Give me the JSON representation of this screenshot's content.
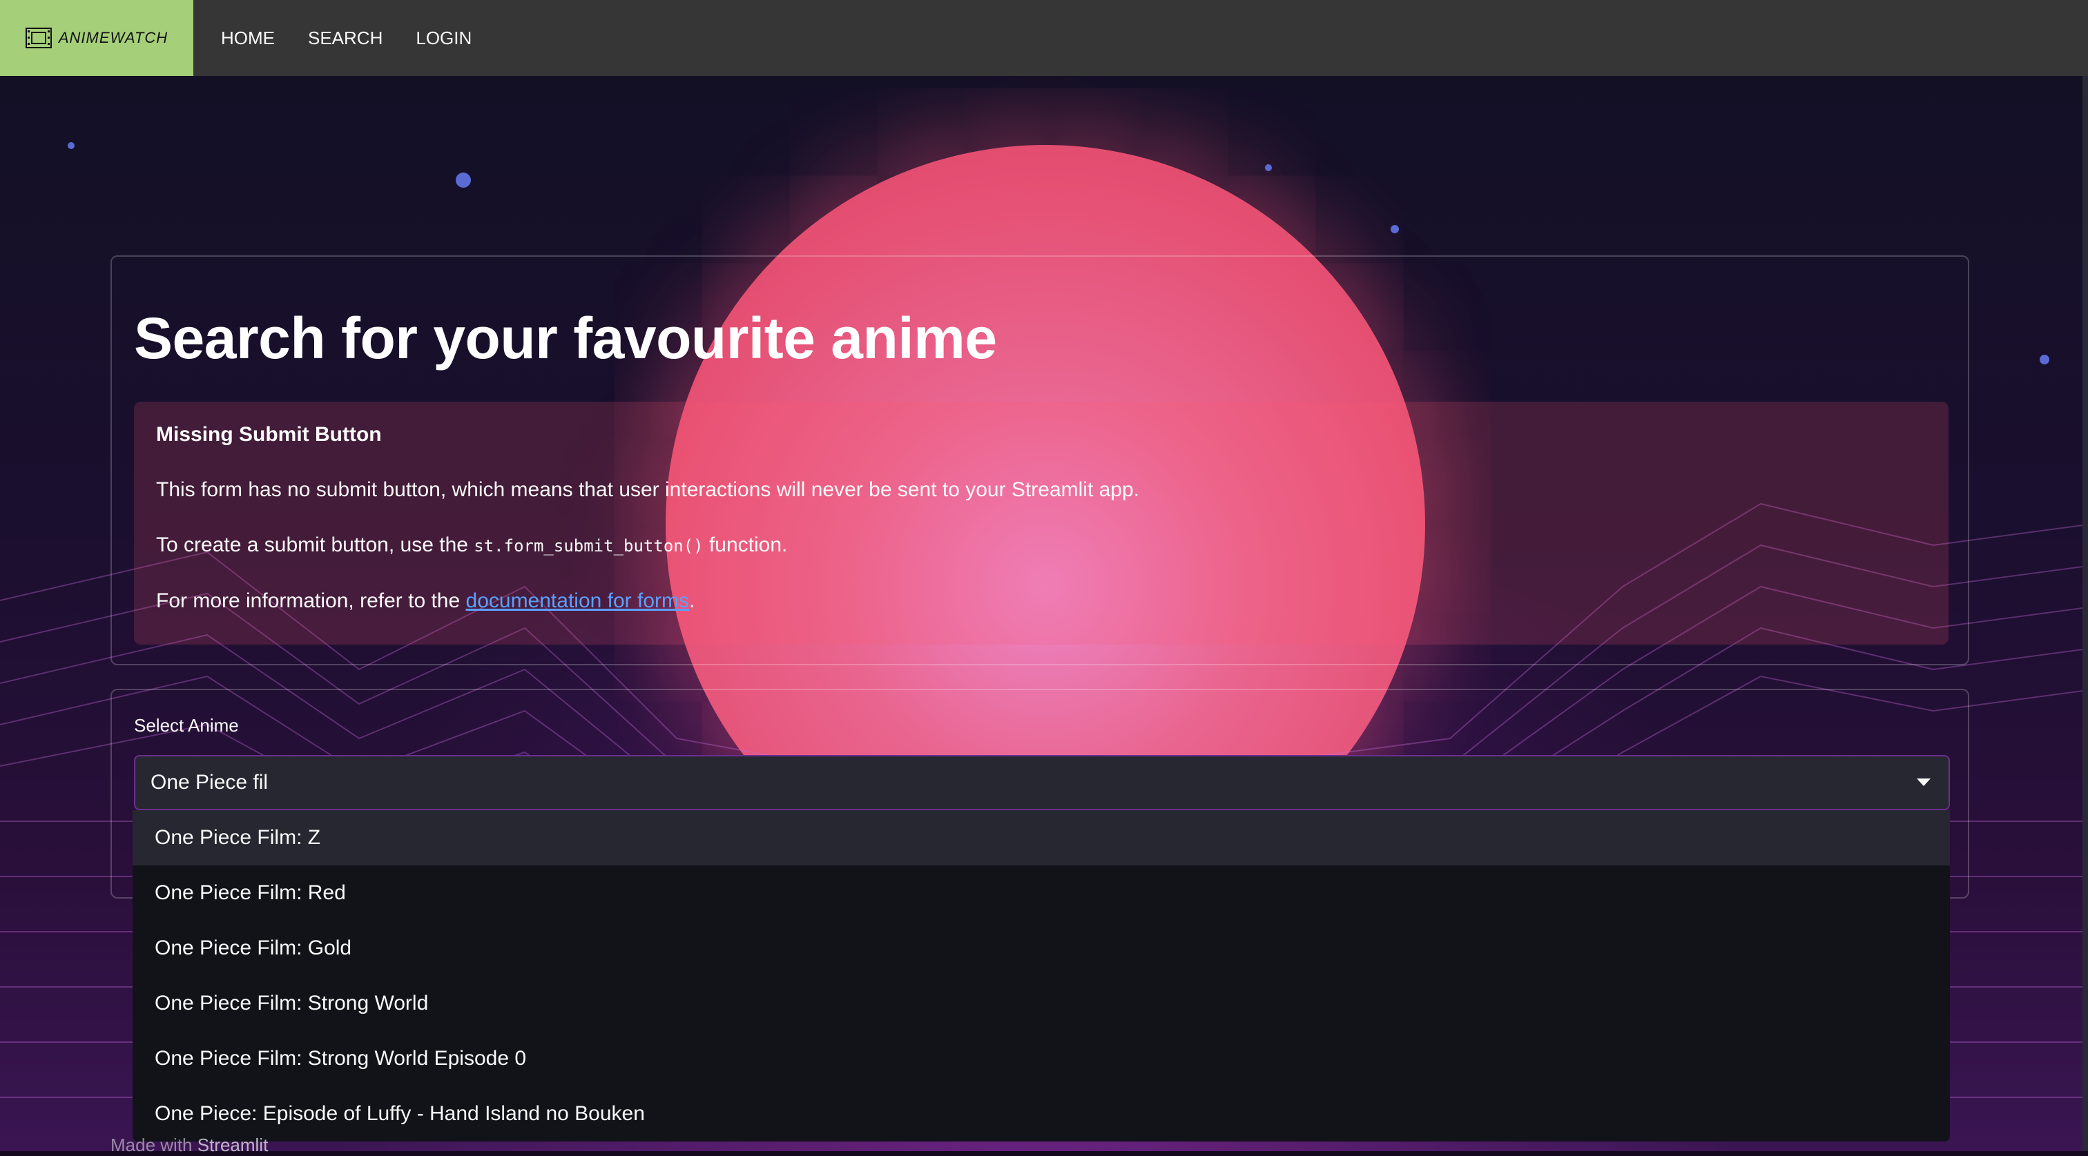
{
  "nav": {
    "logo_text": "ANIMEWATCH",
    "items": [
      "HOME",
      "SEARCH",
      "LOGIN"
    ]
  },
  "page": {
    "title": "Search for your favourite anime"
  },
  "alert": {
    "heading": "Missing Submit Button",
    "line1": "This form has no submit button, which means that user interactions will never be sent to your Streamlit app.",
    "line2_pre": "To create a submit button, use the",
    "line2_code": "st.form_submit_button()",
    "line2_post": "function.",
    "line3_pre": "For more information, refer to the",
    "line3_link": "documentation for forms",
    "line3_post": "."
  },
  "select": {
    "label": "Select Anime",
    "value": "One Piece fil",
    "options": [
      "One Piece Film: Z",
      "One Piece Film: Red",
      "One Piece Film: Gold",
      "One Piece Film: Strong World",
      "One Piece Film: Strong World Episode 0",
      "One Piece: Episode of Luffy - Hand Island no Bouken"
    ]
  },
  "footer": {
    "pre": "Made with",
    "brand": "Streamlit"
  },
  "colors": {
    "navbar": "#363636",
    "logo_bg": "#a6cf7a",
    "alert_bg": "rgba(255,90,110,0.18)",
    "link": "#5aa0ff",
    "select_bg": "#262730",
    "dropdown_bg": "#111319"
  }
}
